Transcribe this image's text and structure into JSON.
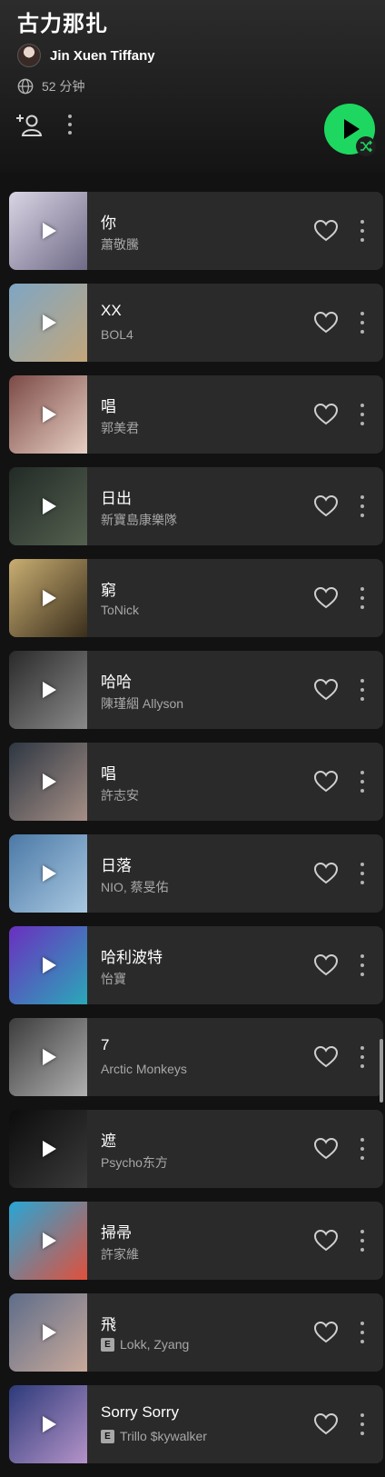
{
  "playlist": {
    "title": "古力那扎",
    "owner": "Jin Xuen Tiffany",
    "duration": "52 分钟"
  },
  "icons": {
    "globe": "globe-icon",
    "add_user": "add-user-icon",
    "more": "more-vertical-icon",
    "play": "play-icon",
    "shuffle": "shuffle-icon",
    "heart": "heart-outline-icon"
  },
  "colors": {
    "accent": "#1ed760",
    "row_bg": "#2a2a2a",
    "subtext": "#a7a7a7"
  },
  "tracks": [
    {
      "title": "你",
      "artist": "蕭敬騰",
      "explicit": false,
      "cover": [
        "#d9d4e4",
        "#6f6a86"
      ]
    },
    {
      "title": "XX",
      "artist": "BOL4",
      "explicit": false,
      "cover": [
        "#7fa6c4",
        "#c2a67a"
      ]
    },
    {
      "title": "唱",
      "artist": "郭美君",
      "explicit": false,
      "cover": [
        "#7c4a46",
        "#e7cfc4"
      ]
    },
    {
      "title": "日出",
      "artist": "新寶島康樂隊",
      "explicit": false,
      "cover": [
        "#222a26",
        "#54604f"
      ]
    },
    {
      "title": "窮",
      "artist": "ToNick",
      "explicit": false,
      "cover": [
        "#c9ae72",
        "#3a2e1c"
      ]
    },
    {
      "title": "哈哈",
      "artist": "陳瑾絪 Allyson",
      "explicit": false,
      "cover": [
        "#2a2a2a",
        "#8a8a8a"
      ]
    },
    {
      "title": "唱",
      "artist": "許志安",
      "explicit": false,
      "cover": [
        "#2e3742",
        "#a58f86"
      ]
    },
    {
      "title": "日落",
      "artist": "NIO, 蔡旻佑",
      "explicit": false,
      "cover": [
        "#4b79a6",
        "#a9c8e1"
      ]
    },
    {
      "title": "哈利波特",
      "artist": "怡寶",
      "explicit": false,
      "cover": [
        "#6a2fc0",
        "#2ba8b8"
      ]
    },
    {
      "title": "7",
      "artist": "Arctic Monkeys",
      "explicit": false,
      "cover": [
        "#3c3c3c",
        "#b0b0b0"
      ]
    },
    {
      "title": "遮",
      "artist": "Psycho东方",
      "explicit": false,
      "cover": [
        "#0c0c0c",
        "#3a3a3a"
      ]
    },
    {
      "title": "掃帚",
      "artist": "許家維",
      "explicit": false,
      "cover": [
        "#28a6d6",
        "#e0503c"
      ]
    },
    {
      "title": "飛",
      "artist": "Lokk, Zyang",
      "explicit": true,
      "cover": [
        "#5e6d8a",
        "#c9a99a"
      ]
    },
    {
      "title": "Sorry Sorry",
      "artist": "Trillo $kywalker",
      "explicit": true,
      "cover": [
        "#2d3a7a",
        "#b493c8"
      ]
    }
  ]
}
